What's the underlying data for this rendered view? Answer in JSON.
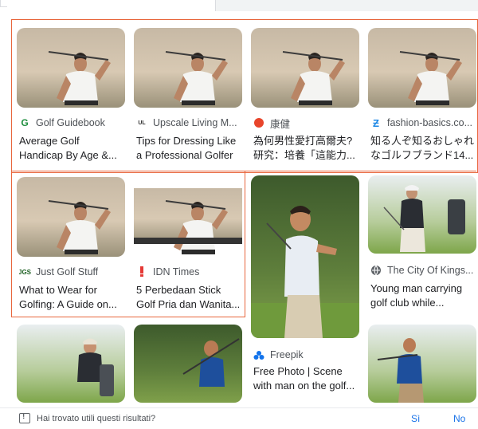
{
  "results": [
    {
      "source": "Golf Guidebook",
      "source_icon": "golf-guidebook-icon",
      "title": "Average Golf Handicap By Age &..."
    },
    {
      "source": "Upscale Living M...",
      "source_icon": "upscale-living-icon",
      "title": "Tips for Dressing Like a Professional Golfer"
    },
    {
      "source": "康健",
      "source_icon": "red-dot-icon",
      "title": "為何男性愛打高爾夫?研究：培養「這能力..."
    },
    {
      "source": "fashion-basics.co...",
      "source_icon": "fashion-basics-icon",
      "title": "知る人ぞ知るおしゃれなゴルフブランド14..."
    },
    {
      "source": "Just Golf Stuff",
      "source_icon": "just-golf-stuff-icon",
      "title": "What to Wear for Golfing: A Guide on..."
    },
    {
      "source": "IDN Times",
      "source_icon": "idn-times-icon",
      "title": "5 Perbedaan Stick Golf Pria dan Wanita..."
    },
    {
      "source": "Freepik",
      "source_icon": "freepik-icon",
      "title": "Free Photo | Scene with man on the golf..."
    },
    {
      "source": "The City Of Kings...",
      "source_icon": "globe-icon",
      "title": "Young man carrying golf club while..."
    },
    {
      "source": "",
      "source_icon": "",
      "title": ""
    },
    {
      "source": "",
      "source_icon": "",
      "title": ""
    },
    {
      "source": "",
      "source_icon": "",
      "title": ""
    }
  ],
  "feedback": {
    "question": "Hai trovato utili questi risultati?",
    "yes": "Sì",
    "no": "No"
  },
  "colors": {
    "selection_outline": "#e8663d",
    "link_blue": "#1a73e8"
  }
}
